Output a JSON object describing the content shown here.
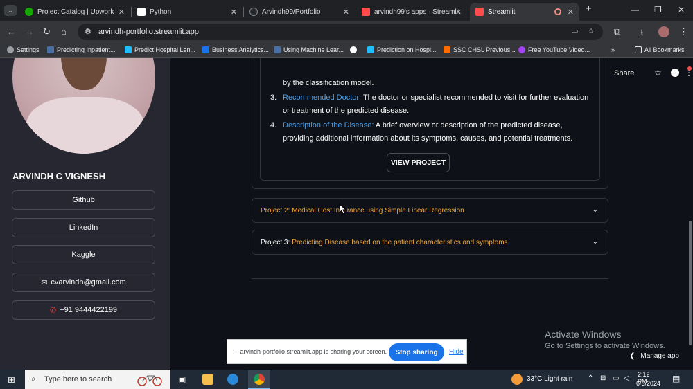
{
  "browser": {
    "tabs": [
      {
        "title": "Project Catalog | Upwork",
        "color": "#14a800"
      },
      {
        "title": "Python",
        "color": "#ffffff"
      },
      {
        "title": "Arvindh99/Portfolio",
        "color": "#24292f"
      },
      {
        "title": "arvindh99's apps · Streamlit",
        "color": "#ff4b4b"
      },
      {
        "title": "Streamlit",
        "color": "#ff4b4b"
      }
    ],
    "url": "arvindh-portfolio.streamlit.app",
    "bookmarks": [
      {
        "label": "Settings",
        "color": "#9aa0a6"
      },
      {
        "label": "Predicting Inpatient...",
        "color": "#4a6fa5"
      },
      {
        "label": "Predict Hospital Len...",
        "color": "#20beff"
      },
      {
        "label": "Business Analytics...",
        "color": "#1a73e8"
      },
      {
        "label": "Using Machine Lear...",
        "color": "#4a6fa5"
      },
      {
        "label": "",
        "color": "#ffffff"
      },
      {
        "label": "Prediction on Hospi...",
        "color": "#20beff"
      },
      {
        "label": "SSC CHSL Previous...",
        "color": "#ff6d00"
      },
      {
        "label": "Free YouTube Video...",
        "color": "#a142f4"
      }
    ],
    "all_bookmarks": "All Bookmarks"
  },
  "sidebar": {
    "name": "ARVINDH C VIGNESH",
    "buttons": {
      "github": "Github",
      "linkedin": "LinkedIn",
      "kaggle": "Kaggle",
      "email": "cvarvindh@gmail.com",
      "phone": "+91 9444422199"
    }
  },
  "header": {
    "share": "Share"
  },
  "project1": {
    "partial_text": "by the classification model.",
    "items": [
      {
        "num": "3.",
        "title": "Recommended Doctor:",
        "text": " The doctor or specialist recommended to visit for further evaluation or treatment of the predicted disease."
      },
      {
        "num": "4.",
        "title": "Description of the Disease:",
        "text": " A brief overview or description of the predicted disease, providing additional information about its symptoms, causes, and potential treatments."
      }
    ],
    "button": "VIEW PROJECT"
  },
  "project2": {
    "prefix": "Project 2:",
    "title": "Medical Cost Insurance using Simple Linear Regression"
  },
  "project3": {
    "prefix": "Project 3:",
    "title": "Predicting Disease based on the patient characteristics and symptoms"
  },
  "windows": {
    "activate_title": "Activate Windows",
    "activate_sub": "Go to Settings to activate Windows."
  },
  "manage_app": "Manage app",
  "share_notice": {
    "text": "arvindh-portfolio.streamlit.app is sharing your screen.",
    "stop": "Stop sharing",
    "hide": "Hide"
  },
  "taskbar": {
    "search_placeholder": "Type here to search",
    "weather": "33°C  Light rain",
    "time": "2:12 PM",
    "date": "6/3/2024"
  }
}
